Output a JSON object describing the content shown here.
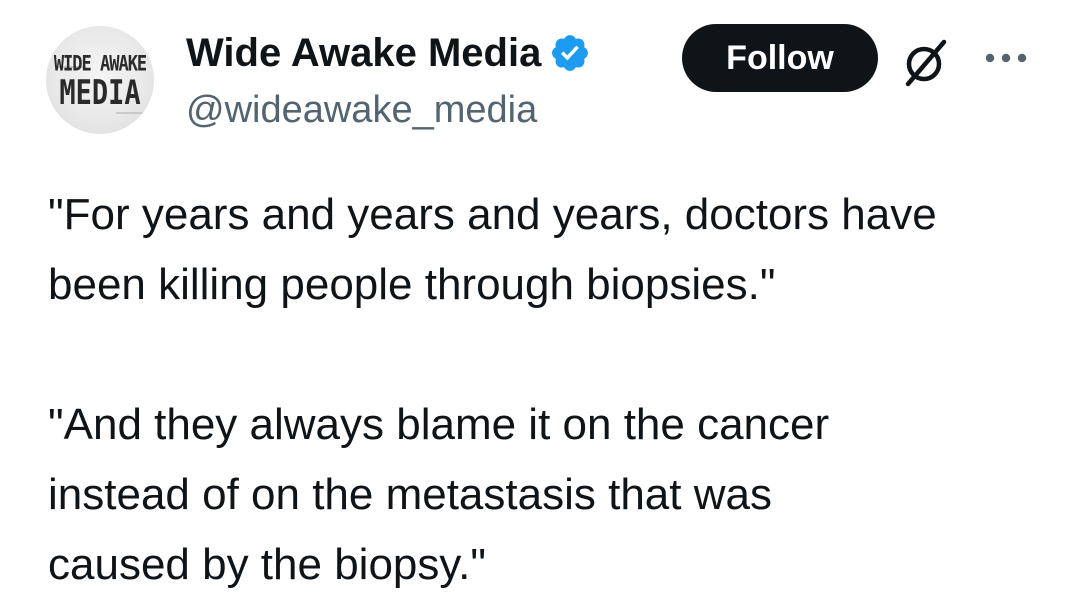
{
  "author": {
    "display_name": "Wide Awake Media",
    "handle": "@wideawake_media",
    "verified": true,
    "verified_color": "#1d9bf0",
    "avatar": {
      "logo_line_1": "WIDE AWAKE",
      "logo_line_2": "MEDIA"
    }
  },
  "actions": {
    "follow_label": "Follow",
    "grok_icon": "grok-icon",
    "more_icon": "more-options-icon"
  },
  "tweet": {
    "paragraphs": [
      "\"For years and years and years, doctors have\nbeen killing people through biopsies.\"",
      "\"And they always blame it on the cancer\ninstead of on the metastasis that was\ncaused by the biopsy.\""
    ]
  },
  "colors": {
    "text": "#0f1419",
    "secondary": "#536471",
    "button_bg": "#0f1419",
    "button_text": "#ffffff"
  }
}
